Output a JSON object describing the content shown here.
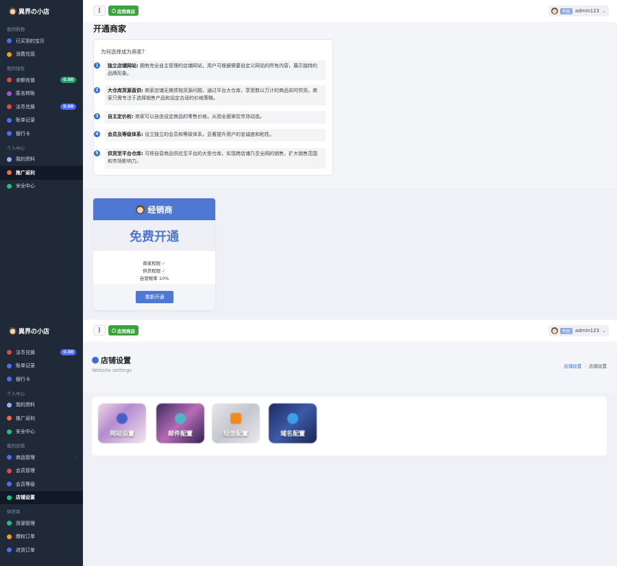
{
  "brand": {
    "name": "異界の小店"
  },
  "top": {
    "app_store_label": "应用商店",
    "user_role": "平民",
    "username": "admin123"
  },
  "sidebar1": {
    "sections": [
      {
        "title": "我的购物",
        "items": [
          {
            "label": "已买到的宝贝",
            "icon": "circle-outline-icon",
            "color": "#4c6ef5"
          },
          {
            "label": "消费兑现",
            "icon": "receipt-icon",
            "color": "#f0a020"
          }
        ]
      },
      {
        "title": "我的钱包",
        "items": [
          {
            "label": "余额充值",
            "icon": "wallet-icon",
            "color": "#e04a3f",
            "badge": "0.00"
          },
          {
            "label": "匿名转账",
            "icon": "transfer-icon",
            "color": "#9b59d0"
          },
          {
            "label": "法币兑换",
            "icon": "exchange-icon",
            "color": "#e04a3f",
            "badge": "0.00"
          },
          {
            "label": "账单记录",
            "icon": "bill-icon",
            "color": "#4c6ef5"
          },
          {
            "label": "银行卡",
            "icon": "card-icon",
            "color": "#4c6ef5"
          }
        ]
      },
      {
        "title": "个人中心",
        "items": [
          {
            "label": "我的资料",
            "icon": "user-icon",
            "color": "#8ab4ff"
          },
          {
            "label": "推广返利",
            "icon": "send-icon",
            "color": "#f06a3a",
            "active": true
          },
          {
            "label": "安全中心",
            "icon": "shield-icon",
            "color": "#22c07a"
          }
        ]
      }
    ]
  },
  "merchant": {
    "page_title": "开通商家",
    "why_title": "为何选择成为商家?",
    "reasons": [
      {
        "num": "1",
        "title": "独立店铺网站:",
        "text": "拥有完全自主管理的店铺网站，用户可根据需要自定义网站的所有内容，展示独特的品牌形象。"
      },
      {
        "num": "2",
        "title": "大仓库货源直供:",
        "text": "商家店铺无需烦恼货源问题，通过平台大仓库，享受数以万计的商品实时供货。商家只需专注于选择销售产品和设定合适的价格策略。"
      },
      {
        "num": "3",
        "title": "自主定价权:",
        "text": "商家可以自由设定商品的零售价格，从而全面掌控市场动态。"
      },
      {
        "num": "4",
        "title": "会员及等级体系:",
        "text": "设立独立的会员和等级体系，显著提升用户的忠诚度和粘性。"
      },
      {
        "num": "5",
        "title": "供货至平台仓库:",
        "text": "可将自营商品供应至平台的大型仓库，实现跨店铺乃至全网的销售，扩大销售范围和市场影响力。"
      }
    ],
    "dealer": {
      "name": "经销商",
      "price": "免费开通",
      "feat1_label": "商家权限",
      "feat2_label": "供货权限",
      "feat3_label": "自营税率",
      "feat3_value": "10%",
      "button": "重新开通"
    }
  },
  "sidebar2": {
    "items_a": [
      {
        "label": "法币兑换",
        "icon": "exchange-icon",
        "color": "#e04a3f",
        "badge": "0.00"
      },
      {
        "label": "账单记录",
        "icon": "bill-icon",
        "color": "#4c6ef5"
      },
      {
        "label": "银行卡",
        "icon": "card-icon",
        "color": "#4c6ef5"
      }
    ],
    "section_personal": "个人中心",
    "items_b": [
      {
        "label": "我的资料",
        "icon": "user-icon",
        "color": "#8ab4ff"
      },
      {
        "label": "推广返利",
        "icon": "send-icon",
        "color": "#f06a3a"
      },
      {
        "label": "安全中心",
        "icon": "shield-icon",
        "color": "#22c07a"
      }
    ],
    "section_store": "我的店铺",
    "items_c": [
      {
        "label": "商品管理",
        "icon": "box-icon",
        "color": "#4c6ef5",
        "chevron": "‹"
      },
      {
        "label": "会员管理",
        "icon": "members-icon",
        "color": "#e04a3f"
      },
      {
        "label": "会员等级",
        "icon": "diamond-icon",
        "color": "#4c6ef5"
      },
      {
        "label": "店铺设置",
        "icon": "settings-icon",
        "color": "#22c07a",
        "active": true
      }
    ],
    "section_supply": "供货商",
    "items_d": [
      {
        "label": "货源管理",
        "icon": "source-icon",
        "color": "#22c07a"
      },
      {
        "label": "缴权订单",
        "icon": "order-icon",
        "color": "#f0a020"
      },
      {
        "label": "进货订单",
        "icon": "purchase-icon",
        "color": "#4c6ef5"
      }
    ]
  },
  "store_settings": {
    "title": "店铺设置",
    "subtitle": "Website settings",
    "breadcrumb_link": "店铺设置",
    "breadcrumb_current": "店铺设置",
    "tiles": [
      {
        "label": "网站设置",
        "icon": "website-icon"
      },
      {
        "label": "邮件配置",
        "icon": "mail-icon"
      },
      {
        "label": "短信配置",
        "icon": "sms-icon"
      },
      {
        "label": "域名配置",
        "icon": "domain-icon"
      }
    ]
  }
}
